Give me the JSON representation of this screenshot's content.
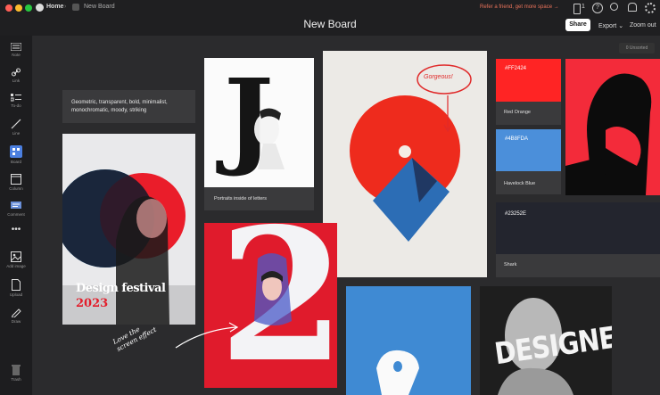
{
  "titlebar": {
    "home": "Home",
    "board": "New Board"
  },
  "promo": "Refer a friend, get more space →",
  "badge_count": "1",
  "header": {
    "title": "New Board",
    "share": "Share",
    "export": "Export",
    "zoom": "Zoom out"
  },
  "tools": [
    {
      "label": "Note",
      "icon": "note-icon"
    },
    {
      "label": "Link",
      "icon": "link-icon"
    },
    {
      "label": "To-do",
      "icon": "todo-icon"
    },
    {
      "label": "Line",
      "icon": "line-icon"
    },
    {
      "label": "Board",
      "icon": "board-icon"
    },
    {
      "label": "Column",
      "icon": "column-icon"
    },
    {
      "label": "Comment",
      "icon": "comment-icon"
    },
    {
      "label": "Add image",
      "icon": "add-image-icon"
    },
    {
      "label": "Upload",
      "icon": "upload-icon"
    },
    {
      "label": "Draw",
      "icon": "draw-icon"
    },
    {
      "label": "Trash",
      "icon": "trash-icon"
    }
  ],
  "unsorted": "0 Unsorted",
  "note_text": "Geometric, transparent, bold, minimalist, monochromatic, moody, striking",
  "poster1": {
    "title": "Design festival",
    "year": "2023"
  },
  "letter_card": {
    "letter": "J",
    "caption": "Portraits inside of letters"
  },
  "poster2": {
    "number": "2"
  },
  "handwriting_1": "Love the",
  "handwriting_2": "screen effect",
  "annotation_word": "Gorgeous!",
  "swatches": [
    {
      "hex": "#FF2424",
      "name": "Red Orange",
      "color": "#ff2424"
    },
    {
      "hex": "#4B8FDA",
      "name": "Havelock Blue",
      "color": "#4b8fda"
    },
    {
      "hex": "#23252E",
      "name": "Shark",
      "color": "#23252e"
    }
  ],
  "designer_word": "DESIGNER"
}
